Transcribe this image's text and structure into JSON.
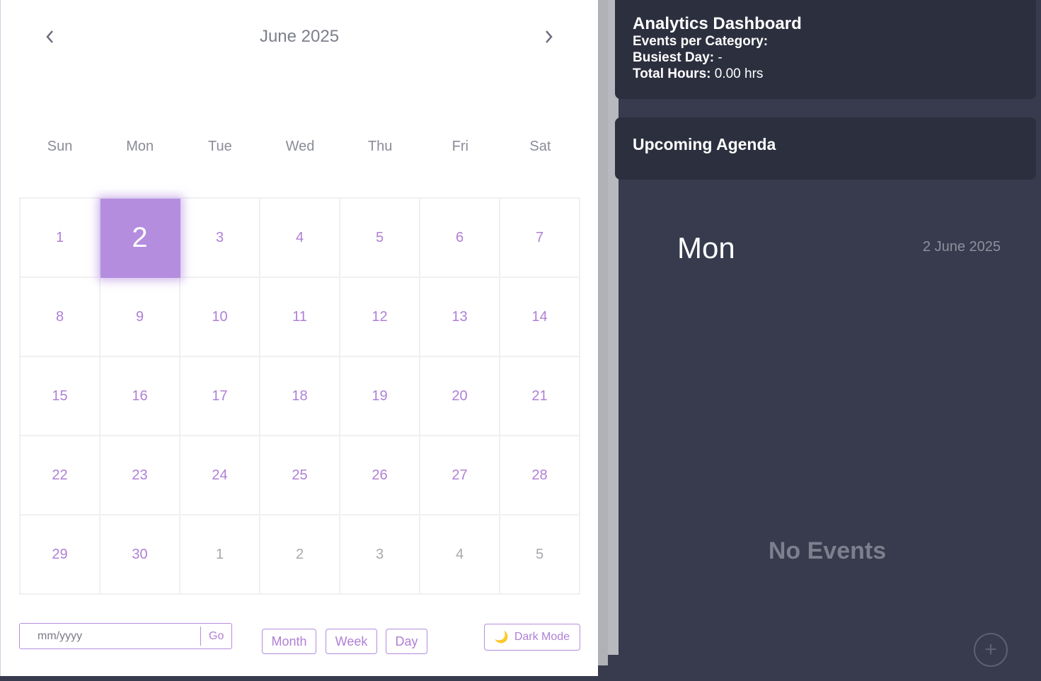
{
  "calendar": {
    "month_title": "June 2025",
    "weekdays": [
      "Sun",
      "Mon",
      "Tue",
      "Wed",
      "Thu",
      "Fri",
      "Sat"
    ],
    "days": [
      {
        "n": "1",
        "other": false
      },
      {
        "n": "2",
        "other": false,
        "today": true
      },
      {
        "n": "3",
        "other": false
      },
      {
        "n": "4",
        "other": false
      },
      {
        "n": "5",
        "other": false
      },
      {
        "n": "6",
        "other": false
      },
      {
        "n": "7",
        "other": false
      },
      {
        "n": "8",
        "other": false
      },
      {
        "n": "9",
        "other": false
      },
      {
        "n": "10",
        "other": false
      },
      {
        "n": "11",
        "other": false
      },
      {
        "n": "12",
        "other": false
      },
      {
        "n": "13",
        "other": false
      },
      {
        "n": "14",
        "other": false
      },
      {
        "n": "15",
        "other": false
      },
      {
        "n": "16",
        "other": false
      },
      {
        "n": "17",
        "other": false
      },
      {
        "n": "18",
        "other": false
      },
      {
        "n": "19",
        "other": false
      },
      {
        "n": "20",
        "other": false
      },
      {
        "n": "21",
        "other": false
      },
      {
        "n": "22",
        "other": false
      },
      {
        "n": "23",
        "other": false
      },
      {
        "n": "24",
        "other": false
      },
      {
        "n": "25",
        "other": false
      },
      {
        "n": "26",
        "other": false
      },
      {
        "n": "27",
        "other": false
      },
      {
        "n": "28",
        "other": false
      },
      {
        "n": "29",
        "other": false
      },
      {
        "n": "30",
        "other": false
      },
      {
        "n": "1",
        "other": true
      },
      {
        "n": "2",
        "other": true
      },
      {
        "n": "3",
        "other": true
      },
      {
        "n": "4",
        "other": true
      },
      {
        "n": "5",
        "other": true
      }
    ]
  },
  "controls": {
    "goto_placeholder": "mm/yyyy",
    "go_label": "Go",
    "month_label": "Month",
    "week_label": "Week",
    "day_label": "Day",
    "dark_mode_label": "Dark Mode",
    "dark_mode_icon": "moon-icon"
  },
  "analytics": {
    "title": "Analytics Dashboard",
    "events_per_category_label": "Events per Category:",
    "busiest_day_label": "Busiest Day:",
    "busiest_day_value": "-",
    "total_hours_label": "Total Hours:",
    "total_hours_value": "0.00 hrs"
  },
  "agenda": {
    "title": "Upcoming Agenda"
  },
  "selected_day": {
    "day_name": "Mon",
    "date": "2 June 2025",
    "empty_message": "No Events",
    "add_label": "+"
  },
  "colors": {
    "accent": "#b48ddf",
    "day_text": "#b07fd6",
    "panel_bg": "#2c2f3e",
    "page_bg": "#373b4d"
  }
}
